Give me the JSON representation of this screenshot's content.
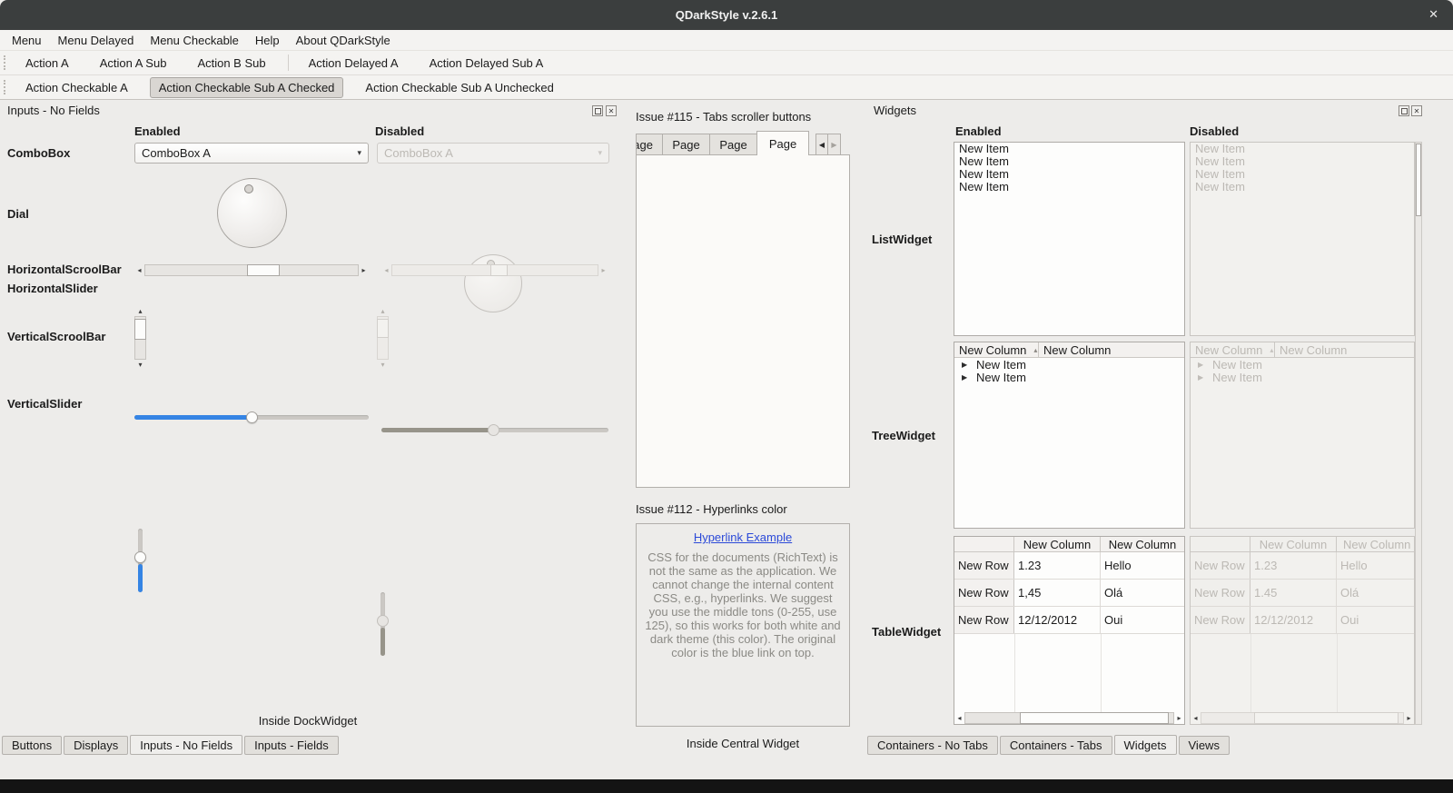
{
  "window": {
    "title": "QDarkStyle v.2.6.1"
  },
  "icons": {
    "close": "✕",
    "left": "◂",
    "right": "▸",
    "up": "▴",
    "down": "▾",
    "combo_arrow": "▾",
    "sort_asc": "▴",
    "branch": "▶",
    "tab_prev": "◀",
    "tab_next": "▶"
  },
  "menubar": {
    "items": [
      "Menu",
      "Menu Delayed",
      "Menu Checkable",
      "Help",
      "About QDarkStyle"
    ]
  },
  "toolbars": {
    "row1": [
      "Action A",
      "Action A Sub",
      "Action B Sub",
      "Action Delayed A",
      "Action Delayed Sub A"
    ],
    "row2": [
      "Action Checkable A",
      "Action Checkable Sub A Checked",
      "Action Checkable Sub A Unchecked"
    ]
  },
  "left_dock": {
    "title": "Inputs - No Fields",
    "enabled_header": "Enabled",
    "disabled_header": "Disabled",
    "labels": {
      "combobox": "ComboBox",
      "dial": "Dial",
      "hscrollbar": "HorizontalScroolBar",
      "hslider": "HorizontalSlider",
      "vscrollbar": "VerticalScroolBar",
      "vslider": "VerticalSlider"
    },
    "combobox_value": "ComboBox A",
    "footer": "Inside DockWidget",
    "tabs": [
      "Buttons",
      "Displays",
      "Inputs - No Fields",
      "Inputs - Fields"
    ],
    "selected_tab": "Inputs - No Fields"
  },
  "central": {
    "tabs_group_title": "Issue #115 - Tabs scroller buttons",
    "tab_labels": [
      "Page",
      "Page",
      "Page",
      "Page"
    ],
    "selected_tab_index": 3,
    "hyperlink_group_title": "Issue #112 - Hyperlinks color",
    "hyperlink_text": "Hyperlink Example",
    "hyperlink_paragraph": "CSS for the documents (RichText) is not the same as the application. We cannot change the internal content CSS, e.g., hyperlinks. We suggest you use the middle tons (0-255, use 125), so this works for both white and dark theme (this color). The original color is the blue link on top.",
    "footer": "Inside Central Widget"
  },
  "right_dock": {
    "title": "Widgets",
    "enabled_header": "Enabled",
    "disabled_header": "Disabled",
    "list_label": "ListWidget",
    "list_items": [
      "New Item",
      "New Item",
      "New Item",
      "New Item"
    ],
    "tree_label": "TreeWidget",
    "tree_col1": "New Column",
    "tree_col2": "New Column",
    "tree_items": [
      "New Item",
      "New Item"
    ],
    "table_label": "TableWidget",
    "table_col1": "New Column",
    "table_col2": "New Column",
    "table_row_header": "New Row",
    "table_rows": [
      {
        "c1": "1.23",
        "c2": "Hello"
      },
      {
        "c1": "1,45",
        "c2": "Olá"
      },
      {
        "c1": "12/12/2012",
        "c2": "Oui"
      }
    ],
    "table_rows_disabled": [
      {
        "c1": "1.23",
        "c2": "Hello"
      },
      {
        "c1": "1.45",
        "c2": "Olá"
      },
      {
        "c1": "12/12/2012",
        "c2": "Oui"
      }
    ],
    "tabs": [
      "Containers - No Tabs",
      "Containers - Tabs",
      "Widgets",
      "Views"
    ],
    "selected_tab": "Widgets"
  },
  "colors": {
    "accent_blue": "#3584e4",
    "link_blue": "#2b49d8",
    "titlebar_bg": "#3b3e3e"
  }
}
